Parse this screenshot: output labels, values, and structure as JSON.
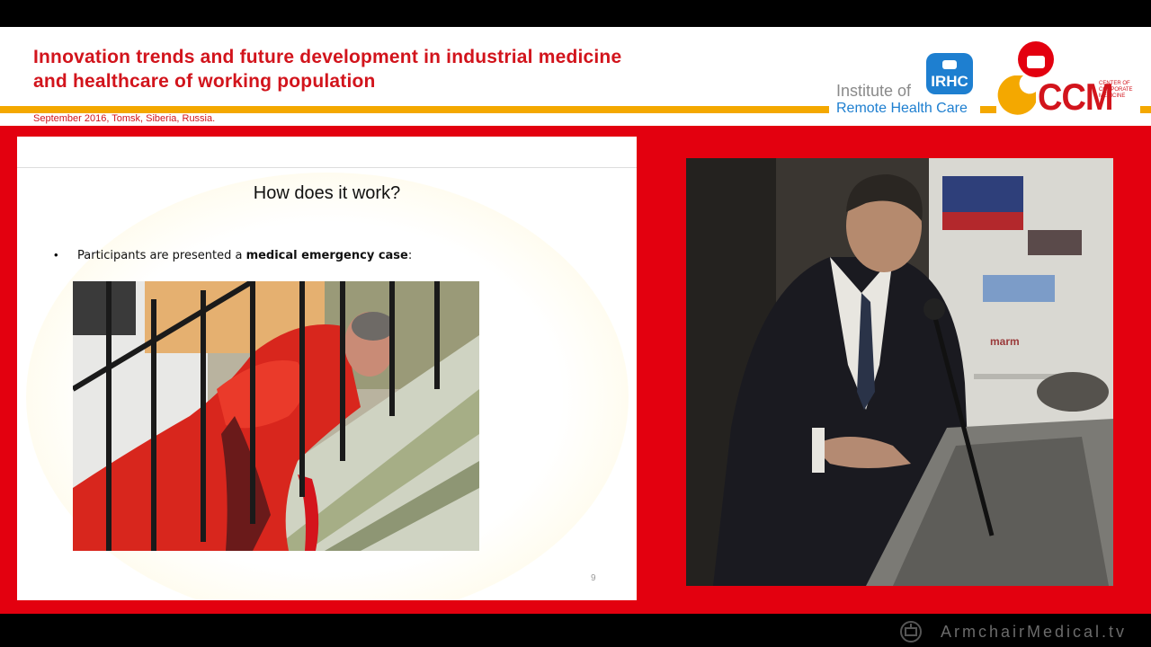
{
  "header": {
    "title_line1": "Innovation trends and future development in industrial medicine",
    "title_line2": "and healthcare of working population",
    "date_location": "September 2016, Tomsk, Siberia, Russia."
  },
  "logos": {
    "irhc": {
      "prefix": "Institute of",
      "badge": "IRHC",
      "subtitle": "Remote Health Care"
    },
    "ccm": {
      "acronym": "CCM",
      "small_line1": "CENTER OF",
      "small_line2": "CORPORATE",
      "small_line3": "MEDICINE"
    }
  },
  "slide": {
    "title": "How does it work?",
    "bullet_prefix": "Participants are presented a ",
    "bullet_bold": "medical emergency case",
    "bullet_suffix": ":",
    "page_number": "9"
  },
  "watermark": {
    "text": "ArmchairMedical.tv",
    "icon": "armchair-medical-logo-icon"
  },
  "colors": {
    "brand_red": "#e3000f",
    "title_red": "#d2141c",
    "stripe_yellow": "#f4a800",
    "irhc_blue": "#1e7fd0"
  }
}
